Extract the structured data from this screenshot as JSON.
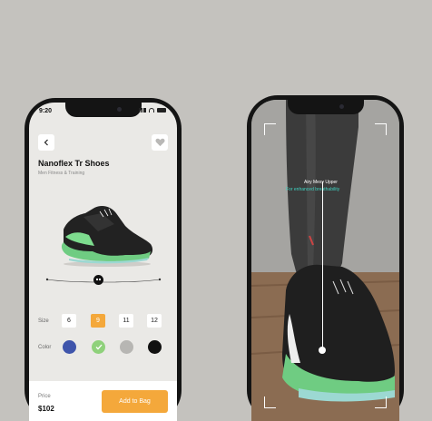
{
  "status_bar": {
    "time": "9:20"
  },
  "product": {
    "title": "Nanoflex Tr Shoes",
    "subtitle": "Men Fitness & Training"
  },
  "size": {
    "label": "Size",
    "options": [
      "6",
      "9",
      "11",
      "12"
    ],
    "selected": "9"
  },
  "color": {
    "label": "Color",
    "options": [
      "#3f55ab",
      "#8fd17b",
      "#b7b6b3",
      "#111111"
    ],
    "selected": "#8fd17b"
  },
  "checkout": {
    "price_label": "Price",
    "price": "$102",
    "add_label": "Add to Bag"
  },
  "ar": {
    "title": "Airy Mesy Upper",
    "subtitle": "For enhanced breathability"
  },
  "colors": {
    "accent": "#f4a83b",
    "ar_highlight": "#3fd5c3"
  }
}
